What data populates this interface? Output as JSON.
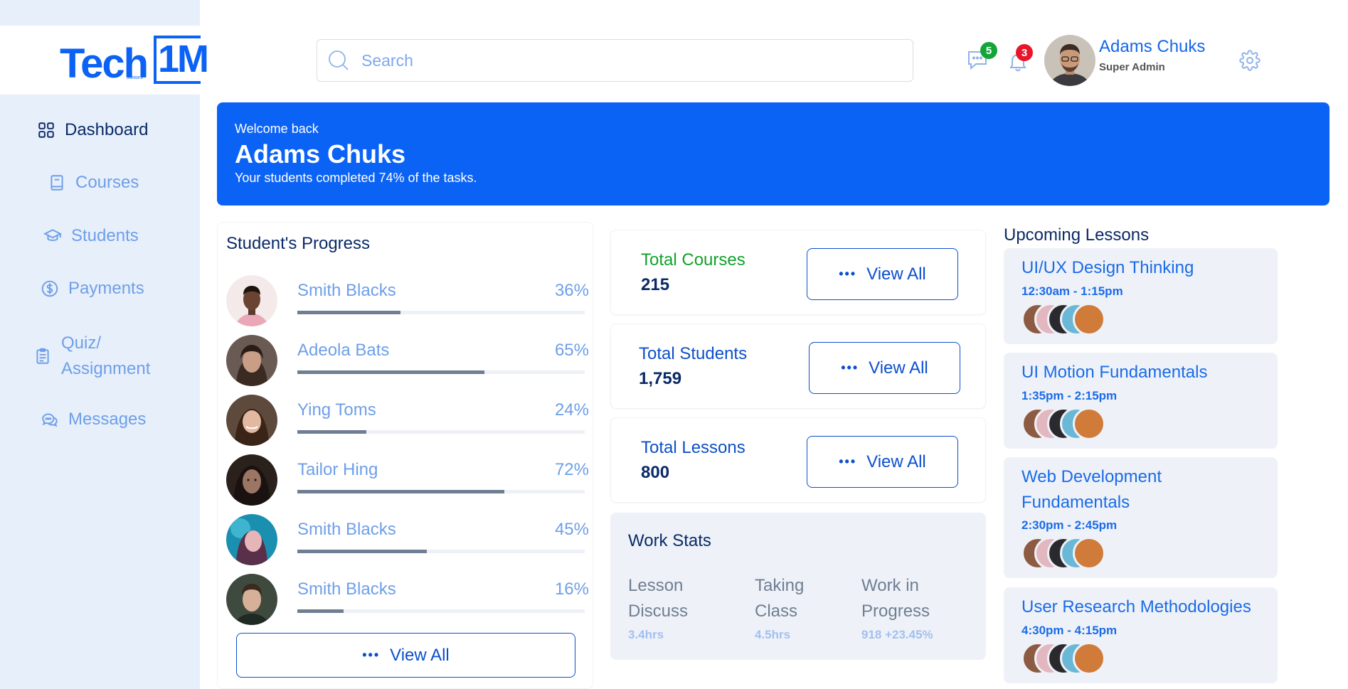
{
  "brand": {
    "logo_main": "Tech",
    "logo_badge": "1M",
    "logo_sub": "Juniors",
    "accent": "#0b62f5"
  },
  "sidebar": {
    "items": [
      {
        "label": "Dashboard",
        "icon": "grid-icon",
        "active": true
      },
      {
        "label": "Courses",
        "icon": "book-icon",
        "active": false
      },
      {
        "label": "Students",
        "icon": "graduation-cap-icon",
        "active": false
      },
      {
        "label": "Payments",
        "icon": "dollar-circle-icon",
        "active": false
      },
      {
        "label": "Quiz/",
        "label2": "Assignment",
        "icon": "clipboard-icon",
        "active": false
      },
      {
        "label": "Messages",
        "icon": "chat-bubbles-icon",
        "active": false
      }
    ]
  },
  "header": {
    "search_placeholder": "Search",
    "messages_count": "5",
    "notifications_count": "3",
    "user_name": "Adams Chuks",
    "user_role": "Super Admin"
  },
  "banner": {
    "greeting": "Welcome back",
    "name": "Adams Chuks",
    "subtitle": "Your students completed 74% of the tasks."
  },
  "progress": {
    "title": "Student's Progress",
    "students": [
      {
        "name": "Smith Blacks",
        "percent_label": "36%",
        "percent": 36
      },
      {
        "name": "Adeola Bats",
        "percent_label": "65%",
        "percent": 65
      },
      {
        "name": "Ying Toms",
        "percent_label": "24%",
        "percent": 24
      },
      {
        "name": "Tailor Hing",
        "percent_label": "72%",
        "percent": 72
      },
      {
        "name": "Smith Blacks",
        "percent_label": "45%",
        "percent": 45
      },
      {
        "name": "Smith Blacks",
        "percent_label": "16%",
        "percent": 16
      }
    ],
    "view_all": "View All"
  },
  "stats": [
    {
      "label": "Total Courses",
      "value": "215",
      "label_color": "#12a12b",
      "button": "View All"
    },
    {
      "label": "Total Students",
      "value": "1,759",
      "label_color": "#0d4fc8",
      "button": "View All"
    },
    {
      "label": "Total Lessons",
      "value": "800",
      "label_color": "#0d4fc8",
      "button": "View All"
    }
  ],
  "work_stats": {
    "title": "Work Stats",
    "columns": [
      {
        "line1": "Lesson",
        "line2": "Discuss",
        "value": "3.4hrs"
      },
      {
        "line1": "Taking",
        "line2": "Class",
        "value": "4.5hrs"
      },
      {
        "line1": "Work in",
        "line2": "Progress",
        "value": "918 +23.45%"
      }
    ]
  },
  "lessons": {
    "title": "Upcoming Lessons",
    "items": [
      {
        "title": "UI/UX Design Thinking",
        "title2": "",
        "time": "12:30am - 1:15pm"
      },
      {
        "title": "UI Motion Fundamentals",
        "title2": "",
        "time": "1:35pm - 2:15pm"
      },
      {
        "title": "Web Development",
        "title2": "Fundamentals",
        "time": "2:30pm - 2:45pm"
      },
      {
        "title": "User Research Methodologies",
        "title2": "",
        "time": "4:30pm - 4:15pm"
      }
    ]
  }
}
